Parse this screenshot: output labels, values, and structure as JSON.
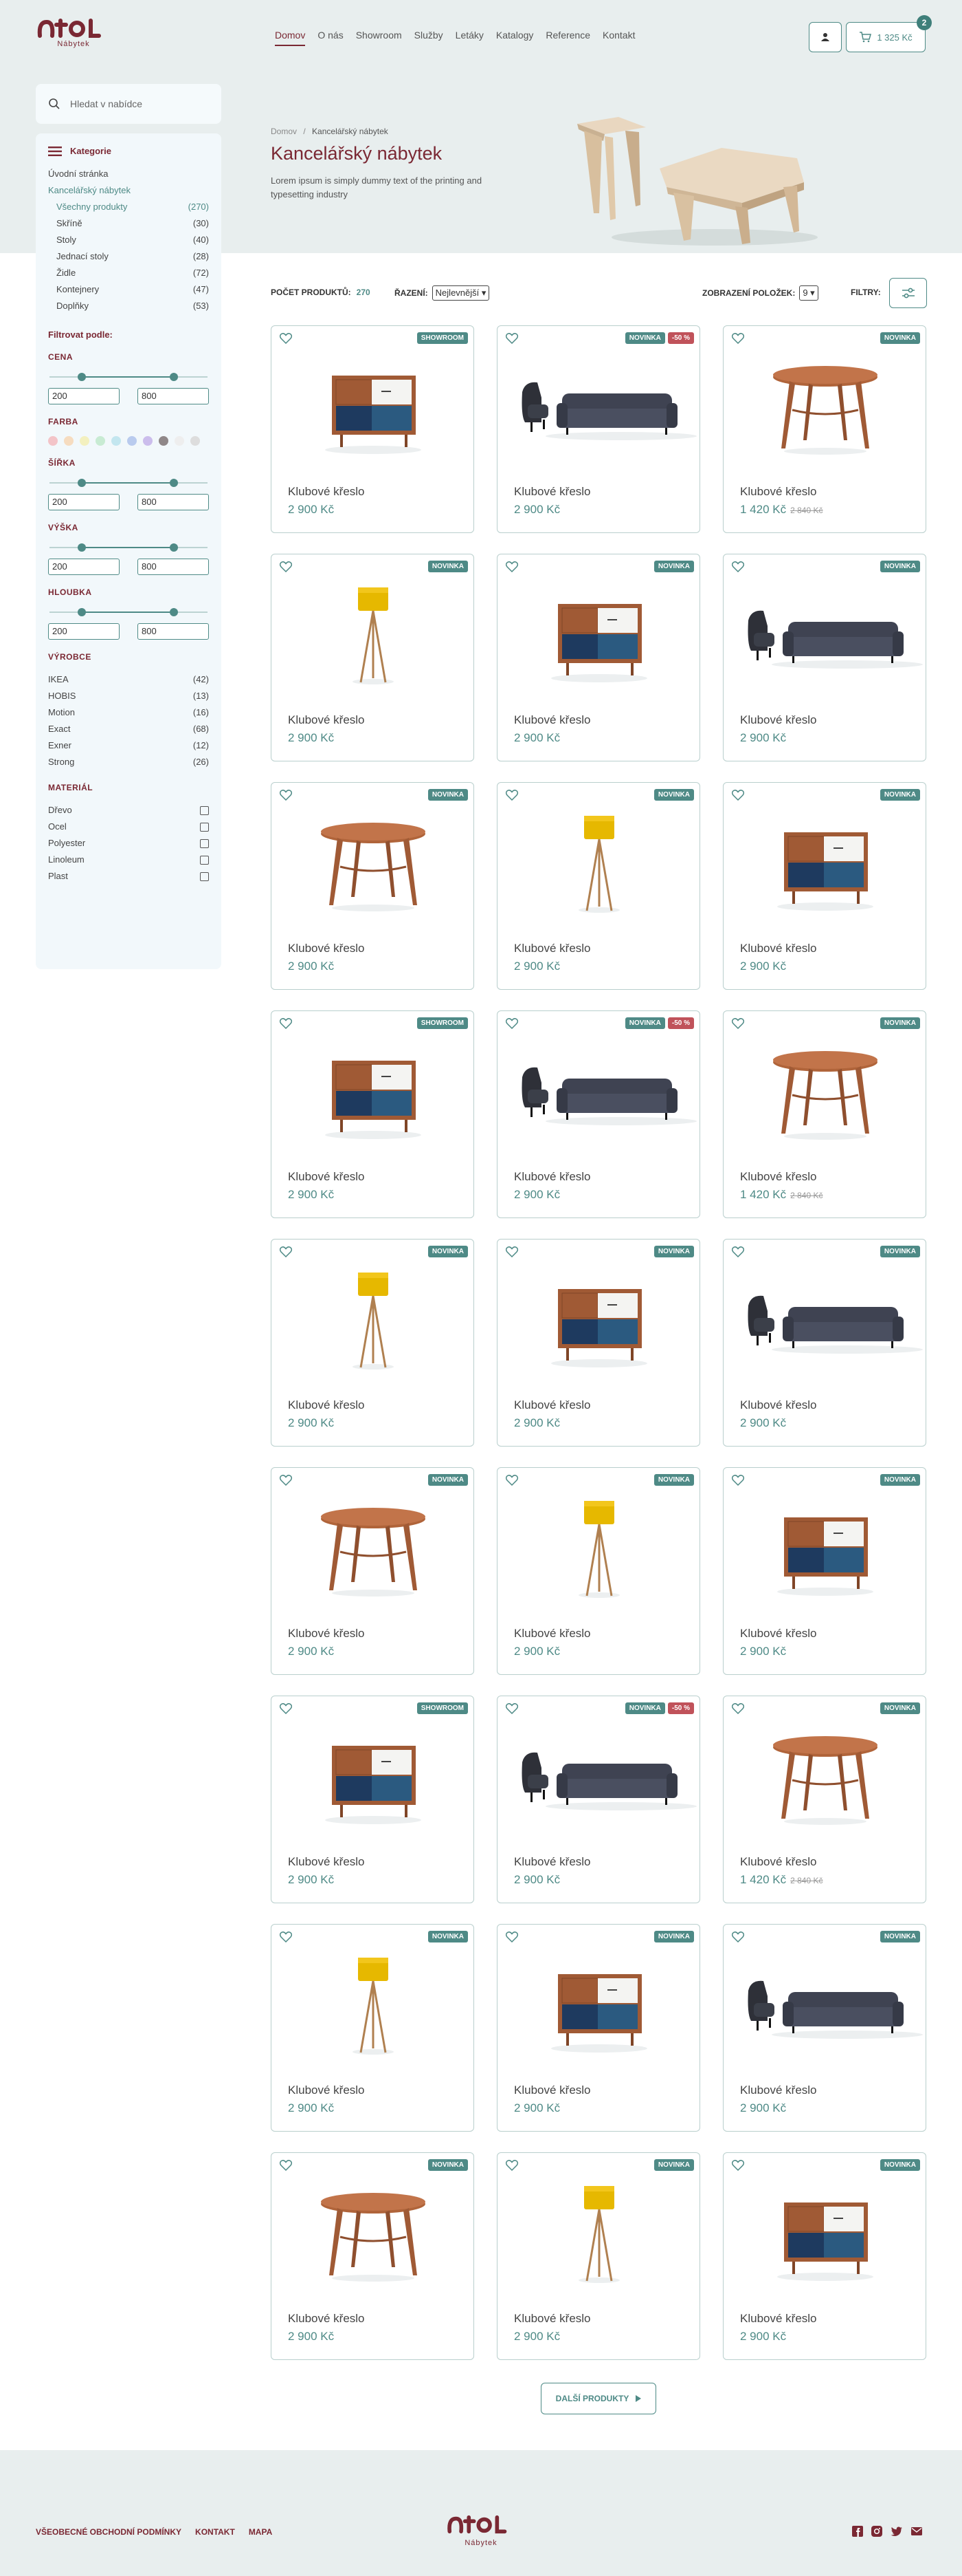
{
  "header": {
    "logo_text": "Atol",
    "logo_sub": "Nábytek",
    "nav": [
      "Domov",
      "O nás",
      "Showroom",
      "Služby",
      "Letáky",
      "Katalogy",
      "Reference",
      "Kontakt"
    ],
    "cart_total": "1 325 Kč",
    "cart_count": "2"
  },
  "search": {
    "placeholder": "Hledat v nabídce"
  },
  "sidebar": {
    "cat_title": "Kategorie",
    "categories": [
      {
        "label": "Úvodní stránka",
        "count": ""
      },
      {
        "label": "Kancelářský nábytek",
        "count": ""
      },
      {
        "label": "Všechny produkty",
        "count": "(270)"
      },
      {
        "label": "Skříně",
        "count": "(30)"
      },
      {
        "label": "Stoly",
        "count": "(40)"
      },
      {
        "label": "Jednací stoly",
        "count": "(28)"
      },
      {
        "label": "Židle",
        "count": "(72)"
      },
      {
        "label": "Kontejnery",
        "count": "(47)"
      },
      {
        "label": "Doplňky",
        "count": "(53)"
      }
    ],
    "filter_title": "Filtrovat podle:",
    "ranges": [
      {
        "label": "CENA",
        "min": "200",
        "max": "800"
      },
      {
        "label": "ŠÍŘKA",
        "min": "200",
        "max": "800"
      },
      {
        "label": "VÝŠKA",
        "min": "200",
        "max": "800"
      },
      {
        "label": "HLOUBKA",
        "min": "200",
        "max": "800"
      }
    ],
    "color_label": "FARBA",
    "colors": [
      "#f3c4c8",
      "#f6dcc0",
      "#f3f0bf",
      "#c8ebd3",
      "#c3e6ef",
      "#b9cbee",
      "#cbbdec",
      "#8f8788",
      "#eeeeee",
      "#dddddd"
    ],
    "brand_label": "VÝROBCE",
    "brands": [
      {
        "label": "IKEA",
        "count": "(42)"
      },
      {
        "label": "HOBIS",
        "count": "(13)"
      },
      {
        "label": "Motion",
        "count": "(16)"
      },
      {
        "label": "Exact",
        "count": "(68)"
      },
      {
        "label": "Exner",
        "count": "(12)"
      },
      {
        "label": "Strong",
        "count": "(26)"
      }
    ],
    "material_label": "MATERIÁL",
    "materials": [
      "Dřevo",
      "Ocel",
      "Polyester",
      "Linoleum",
      "Plast"
    ]
  },
  "hero": {
    "crumb_home": "Domov",
    "crumb_sep": "/",
    "crumb_current": "Kancelářský nábytek",
    "title": "Kancelářský nábytek",
    "text": "Lorem ipsum is simply dummy text of the printing and typesetting industry"
  },
  "toolbar": {
    "count_label": "POČET PRODUKTŮ:",
    "count": "270",
    "sort_label": "ŘAZENÍ:",
    "sort_value": "Nejlevnější",
    "perpage_label": "ZOBRAZENÍ POLOŽEK:",
    "perpage_value": "9",
    "filters_label": "FILTRY:"
  },
  "products": [
    {
      "name": "Klubové křeslo",
      "price": "2 900 Kč",
      "old": "",
      "badges": [
        "SHOWROOM"
      ],
      "img": "cabinet"
    },
    {
      "name": "Klubové křeslo",
      "price": "2 900 Kč",
      "old": "",
      "badges": [
        "NOVINKA",
        "-50 %"
      ],
      "img": "sofa"
    },
    {
      "name": "Klubové křeslo",
      "price": "1 420 Kč",
      "old": "2 840 Kč",
      "badges": [
        "NOVINKA"
      ],
      "img": "table"
    },
    {
      "name": "Klubové křeslo",
      "price": "2 900 Kč",
      "old": "",
      "badges": [
        "NOVINKA"
      ],
      "img": "lamp"
    },
    {
      "name": "Klubové křeslo",
      "price": "2 900 Kč",
      "old": "",
      "badges": [
        "NOVINKA"
      ],
      "img": "cabinet"
    },
    {
      "name": "Klubové křeslo",
      "price": "2 900 Kč",
      "old": "",
      "badges": [
        "NOVINKA"
      ],
      "img": "sofa"
    },
    {
      "name": "Klubové křeslo",
      "price": "2 900 Kč",
      "old": "",
      "badges": [
        "NOVINKA"
      ],
      "img": "table"
    },
    {
      "name": "Klubové křeslo",
      "price": "2 900 Kč",
      "old": "",
      "badges": [
        "NOVINKA"
      ],
      "img": "lamp"
    },
    {
      "name": "Klubové křeslo",
      "price": "2 900 Kč",
      "old": "",
      "badges": [
        "NOVINKA"
      ],
      "img": "cabinet"
    },
    {
      "name": "Klubové křeslo",
      "price": "2 900 Kč",
      "old": "",
      "badges": [
        "SHOWROOM"
      ],
      "img": "cabinet"
    },
    {
      "name": "Klubové křeslo",
      "price": "2 900 Kč",
      "old": "",
      "badges": [
        "NOVINKA",
        "-50 %"
      ],
      "img": "sofa"
    },
    {
      "name": "Klubové křeslo",
      "price": "1 420 Kč",
      "old": "2 840 Kč",
      "badges": [
        "NOVINKA"
      ],
      "img": "table"
    },
    {
      "name": "Klubové křeslo",
      "price": "2 900 Kč",
      "old": "",
      "badges": [
        "NOVINKA"
      ],
      "img": "lamp"
    },
    {
      "name": "Klubové křeslo",
      "price": "2 900 Kč",
      "old": "",
      "badges": [
        "NOVINKA"
      ],
      "img": "cabinet"
    },
    {
      "name": "Klubové křeslo",
      "price": "2 900 Kč",
      "old": "",
      "badges": [
        "NOVINKA"
      ],
      "img": "sofa"
    },
    {
      "name": "Klubové křeslo",
      "price": "2 900 Kč",
      "old": "",
      "badges": [
        "NOVINKA"
      ],
      "img": "table"
    },
    {
      "name": "Klubové křeslo",
      "price": "2 900 Kč",
      "old": "",
      "badges": [
        "NOVINKA"
      ],
      "img": "lamp"
    },
    {
      "name": "Klubové křeslo",
      "price": "2 900 Kč",
      "old": "",
      "badges": [
        "NOVINKA"
      ],
      "img": "cabinet"
    },
    {
      "name": "Klubové křeslo",
      "price": "2 900 Kč",
      "old": "",
      "badges": [
        "SHOWROOM"
      ],
      "img": "cabinet"
    },
    {
      "name": "Klubové křeslo",
      "price": "2 900 Kč",
      "old": "",
      "badges": [
        "NOVINKA",
        "-50 %"
      ],
      "img": "sofa"
    },
    {
      "name": "Klubové křeslo",
      "price": "1 420 Kč",
      "old": "2 840 Kč",
      "badges": [
        "NOVINKA"
      ],
      "img": "table"
    },
    {
      "name": "Klubové křeslo",
      "price": "2 900 Kč",
      "old": "",
      "badges": [
        "NOVINKA"
      ],
      "img": "lamp"
    },
    {
      "name": "Klubové křeslo",
      "price": "2 900 Kč",
      "old": "",
      "badges": [
        "NOVINKA"
      ],
      "img": "cabinet"
    },
    {
      "name": "Klubové křeslo",
      "price": "2 900 Kč",
      "old": "",
      "badges": [
        "NOVINKA"
      ],
      "img": "sofa"
    },
    {
      "name": "Klubové křeslo",
      "price": "2 900 Kč",
      "old": "",
      "badges": [
        "NOVINKA"
      ],
      "img": "table"
    },
    {
      "name": "Klubové křeslo",
      "price": "2 900 Kč",
      "old": "",
      "badges": [
        "NOVINKA"
      ],
      "img": "lamp"
    },
    {
      "name": "Klubové křeslo",
      "price": "2 900 Kč",
      "old": "",
      "badges": [
        "NOVINKA"
      ],
      "img": "cabinet"
    }
  ],
  "more_label": "DALŠÍ PRODUKTY",
  "footer": {
    "links": [
      "VŠEOBECNÉ OBCHODNÍ PODMÍNKY",
      "KONTAKT",
      "MAPA"
    ],
    "logo_sub": "Nábytek",
    "social": [
      "facebook-icon",
      "instagram-icon",
      "twitter-icon",
      "mail-icon"
    ]
  }
}
